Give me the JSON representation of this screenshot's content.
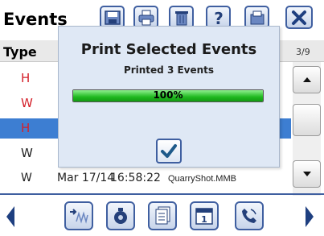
{
  "header": {
    "title": "Events",
    "toolbar": [
      "save-icon",
      "print-icon",
      "delete-icon",
      "help-icon",
      "export-icon",
      "close-icon"
    ]
  },
  "table": {
    "type_header": "Type",
    "count": "3/9",
    "rows": [
      {
        "type": "H",
        "color": "#d4202a"
      },
      {
        "type": "W",
        "color": "#d4202a"
      },
      {
        "type": "H",
        "color": "#d4202a",
        "selected": true
      },
      {
        "type": "W",
        "color": "#222222"
      },
      {
        "type": "W",
        "color": "#222222",
        "date": "Mar 17/14",
        "time": "16:58:22",
        "file": "QuarryShot.MMB"
      }
    ]
  },
  "dialog": {
    "title": "Print Selected Events",
    "status": "Printed 3 Events",
    "progress_text": "100%",
    "progress": 1.0,
    "ok_icon": "checkmark-icon"
  },
  "bottom_bar": {
    "items": [
      "previous-arrow-icon",
      "waveform-icon",
      "monitor-icon",
      "documents-icon",
      "calendar-icon",
      "phone-icon",
      "next-arrow-icon"
    ]
  },
  "colors": {
    "accent": "#3f5fa0",
    "selection": "#3d7ed2",
    "event_red": "#d4202a",
    "dialog_bg": "#dfe8f5",
    "progress_green": "#1fb81f"
  }
}
